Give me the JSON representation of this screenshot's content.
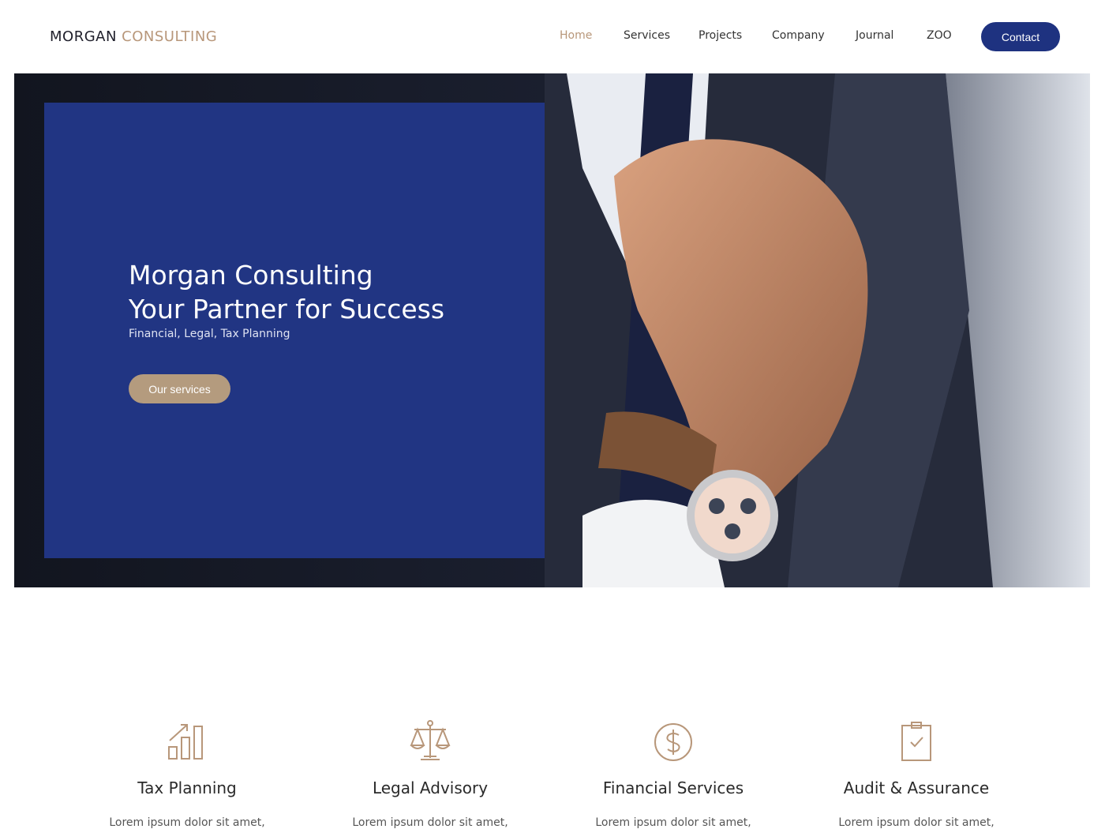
{
  "header": {
    "logo": {
      "part1": "MORGAN",
      "part2": "CONSULTING"
    },
    "nav": [
      {
        "label": "Home",
        "active": true
      },
      {
        "label": "Services",
        "active": false
      },
      {
        "label": "Projects",
        "active": false
      },
      {
        "label": "Company",
        "active": false
      },
      {
        "label": "Journal",
        "active": false
      },
      {
        "label": "ZOO",
        "active": false
      }
    ],
    "contact_label": "Contact"
  },
  "hero": {
    "title_line1": "Morgan Consulting",
    "title_line2": "Your Partner for Success",
    "subtitle": "Financial, Legal, Tax Planning",
    "button_label": "Our services"
  },
  "features": [
    {
      "icon": "bar-chart-growth-icon",
      "title": "Tax Planning",
      "text": "Lorem ipsum dolor sit amet,"
    },
    {
      "icon": "balance-scale-icon",
      "title": "Legal Advisory",
      "text": "Lorem ipsum dolor sit amet,"
    },
    {
      "icon": "dollar-circle-icon",
      "title": "Financial Services",
      "text": "Lorem ipsum dolor sit amet,"
    },
    {
      "icon": "clipboard-check-icon",
      "title": "Audit & Assurance",
      "text": "Lorem ipsum dolor sit amet,"
    }
  ],
  "colors": {
    "brand_navy": "#213583",
    "accent_gold": "#b8977a",
    "button_gold": "#b49b7e"
  }
}
